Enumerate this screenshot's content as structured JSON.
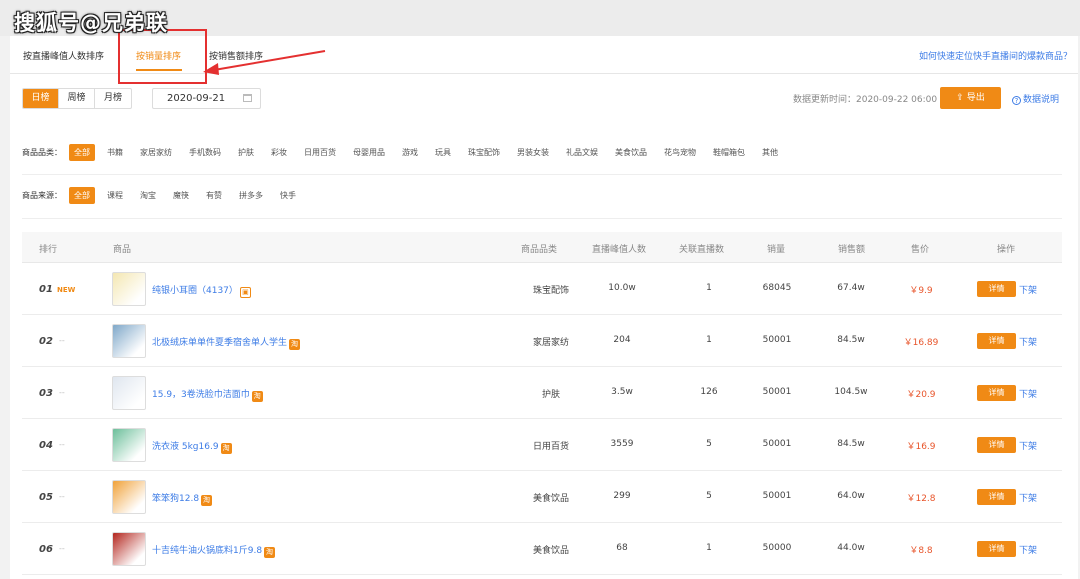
{
  "watermark": "搜狐号@兄弟联",
  "tabs": [
    {
      "label": "按直播峰值人数排序",
      "active": false
    },
    {
      "label": "按销量排序",
      "active": true
    },
    {
      "label": "按销售额排序",
      "active": false
    }
  ],
  "help_link": "如何快速定位快手直播间的爆款商品？",
  "periods": [
    "日榜",
    "周榜",
    "月榜"
  ],
  "selected_period": "日榜",
  "date_value": "2020-09-21",
  "update_time": "数据更新时间：2020-09-22 06:00",
  "export_label": "导出",
  "data_help_label": "数据说明",
  "category_filter": {
    "label": "商品品类：",
    "options": [
      "全部",
      "书籍",
      "家居家纺",
      "手机数码",
      "护肤",
      "彩妆",
      "日用百货",
      "母婴用品",
      "游戏",
      "玩具",
      "珠宝配饰",
      "男装女装",
      "礼品文娱",
      "美食饮品",
      "花鸟宠物",
      "鞋帽箱包",
      "其他"
    ],
    "selected": "全部"
  },
  "source_filter": {
    "label": "商品来源：",
    "options": [
      "全部",
      "课程",
      "淘宝",
      "魔筷",
      "有赞",
      "拼多多",
      "快手"
    ],
    "selected": "全部"
  },
  "table": {
    "headers": [
      "排行",
      "商品",
      "商品品类",
      "直播峰值人数",
      "关联直播数",
      "销量",
      "销售额",
      "售价",
      "操作"
    ],
    "detail_label": "详情",
    "offshelf_label": "下架",
    "rows": [
      {
        "rank": "01",
        "tag": "NEW",
        "name": "纯银小耳圈（4137）",
        "badge": "outline",
        "category": "珠宝配饰",
        "peak": "10.0w",
        "lives": "1",
        "sales": "68045",
        "revenue": "67.4w",
        "price": "￥9.9",
        "thumb_color": "#f4e7b2"
      },
      {
        "rank": "02",
        "tag": "--",
        "name": "北极绒床单单件夏季宿舍单人学生",
        "badge": "tb",
        "category": "家居家纺",
        "peak": "204",
        "lives": "1",
        "sales": "50001",
        "revenue": "84.5w",
        "price": "￥16.89",
        "thumb_color": "#7fa8c9"
      },
      {
        "rank": "03",
        "tag": "--",
        "name": "15.9，3卷洗脸巾洁面巾",
        "badge": "tb",
        "category": "护肤",
        "peak": "3.5w",
        "lives": "126",
        "sales": "50001",
        "revenue": "104.5w",
        "price": "￥20.9",
        "thumb_color": "#dfe6ef"
      },
      {
        "rank": "04",
        "tag": "--",
        "name": "洗衣液 5kg16.9",
        "badge": "tb",
        "category": "日用百货",
        "peak": "3559",
        "lives": "5",
        "sales": "50001",
        "revenue": "84.5w",
        "price": "￥16.9",
        "thumb_color": "#6cbf9a"
      },
      {
        "rank": "05",
        "tag": "--",
        "name": "笨笨狗12.8",
        "badge": "tb",
        "category": "美食饮品",
        "peak": "299",
        "lives": "5",
        "sales": "50001",
        "revenue": "64.0w",
        "price": "￥12.8",
        "thumb_color": "#f0a23a"
      },
      {
        "rank": "06",
        "tag": "--",
        "name": "十吉纯牛油火锅底料1斤9.8",
        "badge": "tb",
        "category": "美食饮品",
        "peak": "68",
        "lives": "1",
        "sales": "50000",
        "revenue": "44.0w",
        "price": "￥8.8",
        "thumb_color": "#b3261e"
      }
    ]
  }
}
